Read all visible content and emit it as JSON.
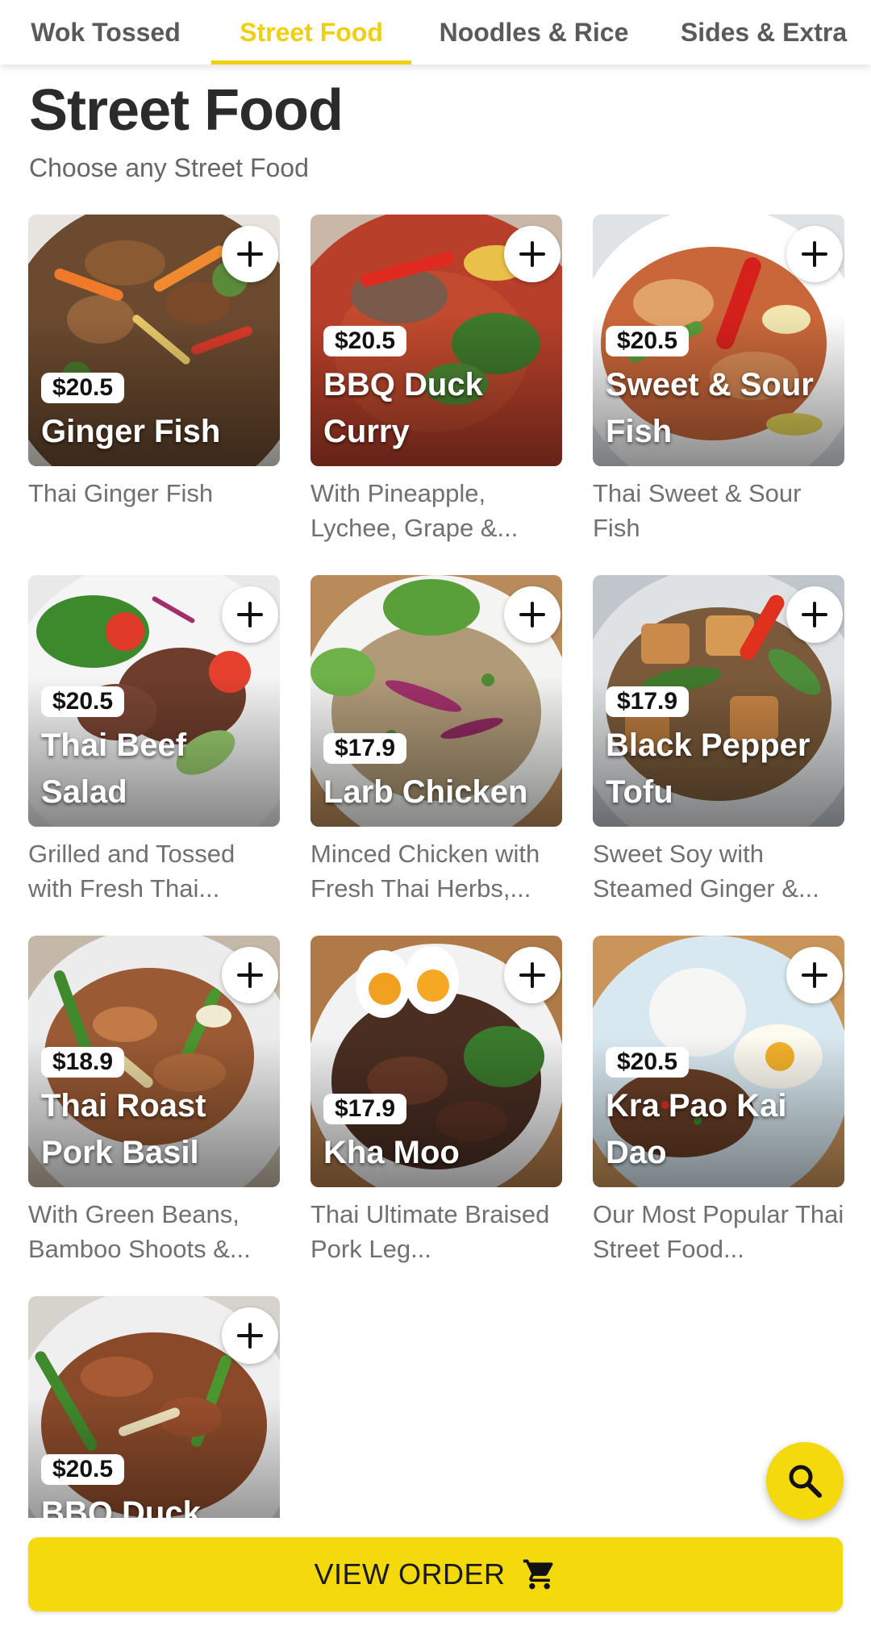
{
  "tabs": [
    {
      "label": "Wok Tossed",
      "active": false
    },
    {
      "label": "Street Food",
      "active": true
    },
    {
      "label": "Noodles & Rice",
      "active": false
    },
    {
      "label": "Sides & Extra",
      "active": false
    }
  ],
  "section": {
    "title": "Street Food",
    "subtitle": "Choose any Street Food"
  },
  "items": [
    {
      "name": "Ginger Fish",
      "price": "$20.5",
      "description": "Thai Ginger Fish",
      "image": "stir-fried fish with vegetables"
    },
    {
      "name": "BBQ Duck Curry",
      "price": "$20.5",
      "description": "With Pineapple, Lychee, Grape &...",
      "image": "red duck curry with basil"
    },
    {
      "name": "Sweet & Sour Fish",
      "price": "$20.5",
      "description": "Thai Sweet & Sour Fish",
      "image": "sweet and sour fish with peppers"
    },
    {
      "name": "Thai Beef Salad",
      "price": "$20.5",
      "description": "Grilled and Tossed with Fresh Thai...",
      "image": "beef salad with tomato and cucumber"
    },
    {
      "name": "Larb Chicken",
      "price": "$17.9",
      "description": "Minced Chicken with Fresh Thai Herbs,...",
      "image": "minced chicken larb with mint"
    },
    {
      "name": "Black Pepper Tofu",
      "price": "$17.9",
      "description": "Sweet Soy with Steamed Ginger &...",
      "image": "tofu with bok choy and peppers"
    },
    {
      "name": "Thai Roast Pork Basil",
      "price": "$18.9",
      "description": "With Green Beans, Bamboo Shoots &...",
      "image": "roast pork with green beans"
    },
    {
      "name": "Kha Moo",
      "price": "$17.9",
      "description": "Thai Ultimate Braised Pork Leg...",
      "image": "braised pork leg with eggs"
    },
    {
      "name": "Kra Pao Kai Dao",
      "price": "$20.5",
      "description": "Our Most Popular Thai Street Food...",
      "image": "rice with fried egg and minced meat"
    },
    {
      "name": "BBQ Duck Basil",
      "price": "$20.5",
      "description": "",
      "image": "duck basil stir fry"
    }
  ],
  "actions": {
    "view_order_label": "VIEW ORDER",
    "cart_icon": "cart-icon",
    "search_icon": "search-icon",
    "add_icon": "plus-icon"
  },
  "colors": {
    "accent": "#f4d90c",
    "tab_active": "#f0cf10",
    "text_dark": "#2b2b2b",
    "text_muted": "#707070"
  }
}
